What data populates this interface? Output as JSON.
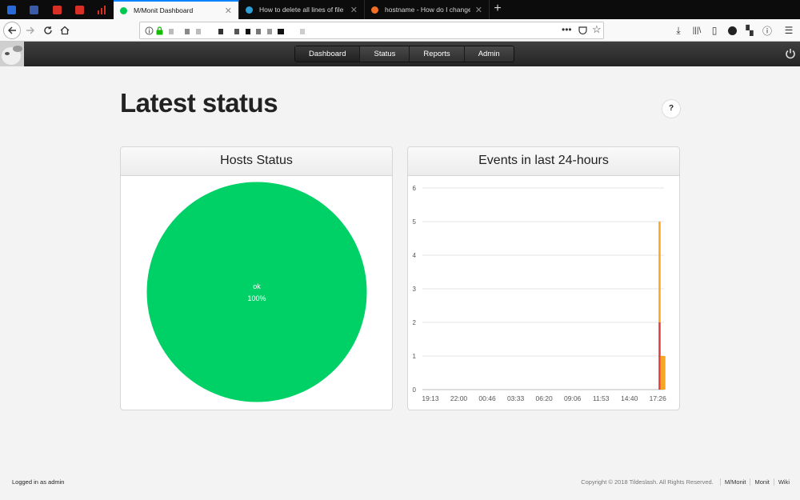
{
  "browser": {
    "tabs": [
      {
        "title": "M/Monit Dashboard",
        "active": true,
        "favicon_color": "#00c853"
      },
      {
        "title": "How to delete all lines of file in",
        "active": false,
        "favicon_color": "#2f9fd8"
      },
      {
        "title": "hostname - How do I change th",
        "active": false,
        "favicon_color": "#f26e22"
      }
    ],
    "new_tab_label": "+"
  },
  "app": {
    "menu": [
      "Dashboard",
      "Status",
      "Reports",
      "Admin"
    ]
  },
  "page": {
    "title": "Latest status",
    "help_label": "?"
  },
  "hosts_panel": {
    "title": "Hosts Status",
    "slice_label": "ok",
    "slice_percent": "100%",
    "slice_color": "#00d166"
  },
  "events_panel": {
    "title": "Events in last 24-hours"
  },
  "chart_data": [
    {
      "type": "pie",
      "slices": [
        {
          "label": "ok",
          "value": 100,
          "percent": "100%",
          "color": "#00d166"
        }
      ]
    },
    {
      "type": "bar",
      "title": "Events in last 24-hours",
      "categories": [
        "19:13",
        "22:00",
        "00:46",
        "03:33",
        "06:20",
        "09:06",
        "11:53",
        "14:40",
        "17:26"
      ],
      "ylim": [
        0,
        6
      ],
      "yticks": [
        0,
        1,
        2,
        3,
        4,
        5,
        6
      ],
      "grid": true,
      "bars": [
        {
          "x": "17:26",
          "stack": [
            {
              "value": 2,
              "color": "#d93c3c"
            },
            {
              "value": 3,
              "color": "#f5a623"
            }
          ]
        },
        {
          "x": "17:26+",
          "stack": [
            {
              "value": 1,
              "color": "#f5a623"
            }
          ]
        }
      ]
    }
  ],
  "footer": {
    "logged_in": "Logged in as admin",
    "copyright": "Copyright © 2018 Tildeslash. All Rights Reserved.",
    "links": [
      "M/Monit",
      "Monit",
      "Wiki"
    ]
  }
}
